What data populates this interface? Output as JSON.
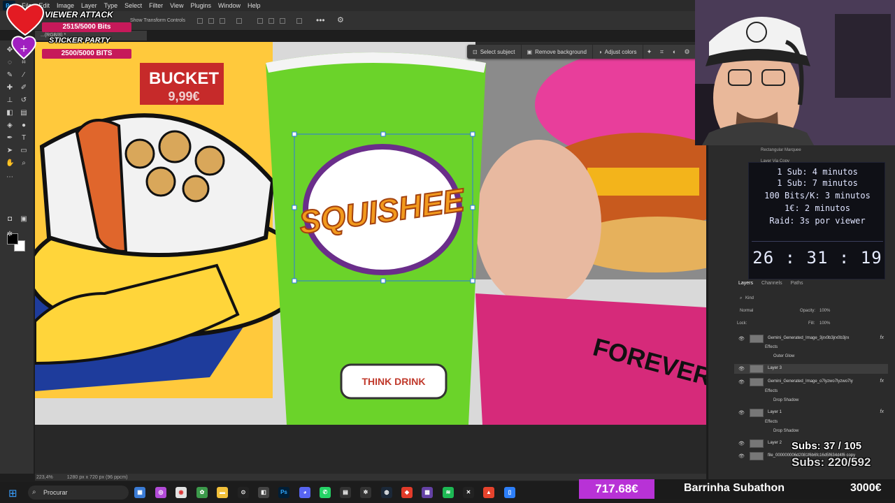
{
  "app": {
    "logo": "Ps",
    "menu": [
      "File",
      "Edit",
      "Image",
      "Layer",
      "Type",
      "Select",
      "Filter",
      "View",
      "Plugins",
      "Window",
      "Help"
    ],
    "options": {
      "transform_label": "Show Transform Controls"
    },
    "doc_tab": "...(RGB/8) *"
  },
  "context_bar": {
    "select_subject": "Select subject",
    "remove_background": "Remove background",
    "adjust_colors": "Adjust colors"
  },
  "canvas": {
    "bucket_sign": "BUCKET",
    "price_sign": "9,99€",
    "cup_logo": "SQUISHEE",
    "cup_label": "THINK DRINK",
    "box_text": "FOREVER"
  },
  "status": {
    "zoom": "223,4%",
    "doc_info": "1280 px x 720 px (96 ppcm)"
  },
  "history": [
    "Rectangular Marquee",
    "Layer Via Copy"
  ],
  "timer": {
    "lines": [
      "1 Sub: 4 minutos",
      "1 Sub: 7 minutos",
      "100 Bits/K: 3 minutos",
      "1€: 2 minutos",
      "Raid: 3s por viewer"
    ],
    "countdown": "26 : 31 : 19"
  },
  "layers_panel": {
    "tabs": [
      "Layers",
      "Channels",
      "Paths"
    ],
    "kind": "Kind",
    "blend_mode": "Normal",
    "opacity_label": "Opacity:",
    "opacity_value": "100%",
    "lock_label": "Lock:",
    "fill_label": "Fill:",
    "fill_value": "100%",
    "layers": [
      {
        "name": "Gemini_Generated_Image_3jrx0b3jrx0b3jrx",
        "fx": "fx",
        "effects": "Effects",
        "effect": "Outer Glow"
      },
      {
        "name": "Layer 3"
      },
      {
        "name": "Gemini_Generated_Image_o7lyzwo7lyzwo7ly",
        "fx": "fx",
        "effects": "Effects",
        "effect": "Drop Shadow"
      },
      {
        "name": "Layer 1",
        "fx": "fx",
        "effects": "Effects",
        "effect": "Drop Shadow"
      },
      {
        "name": "Layer 2"
      },
      {
        "name": "file_000000006d2081f6b6fc16d5f634d4f6 copy"
      }
    ]
  },
  "overlay": {
    "viewer_attack": "VIEWER ATTACK",
    "viewer_bits": "2515/5000 Bits",
    "viewer_progress": 0.503,
    "sticker_party": "STICKER PARTY",
    "sticker_bits": "2500/5000 BITS",
    "sticker_progress": 0.5,
    "subs_1": "Subs: 37 / 105",
    "subs_2": "Subs: 220/592",
    "money": "717.68€",
    "bar_label": "Barrinha Subathon",
    "goal": "3000€",
    "money_progress": 0.239
  },
  "taskbar": {
    "search": "Procurar"
  },
  "colors": {
    "accent_pink": "#c6195a",
    "money_purple": "#b832d6",
    "cup_green": "#6bd32a",
    "donut_pink": "#e83e9b"
  }
}
